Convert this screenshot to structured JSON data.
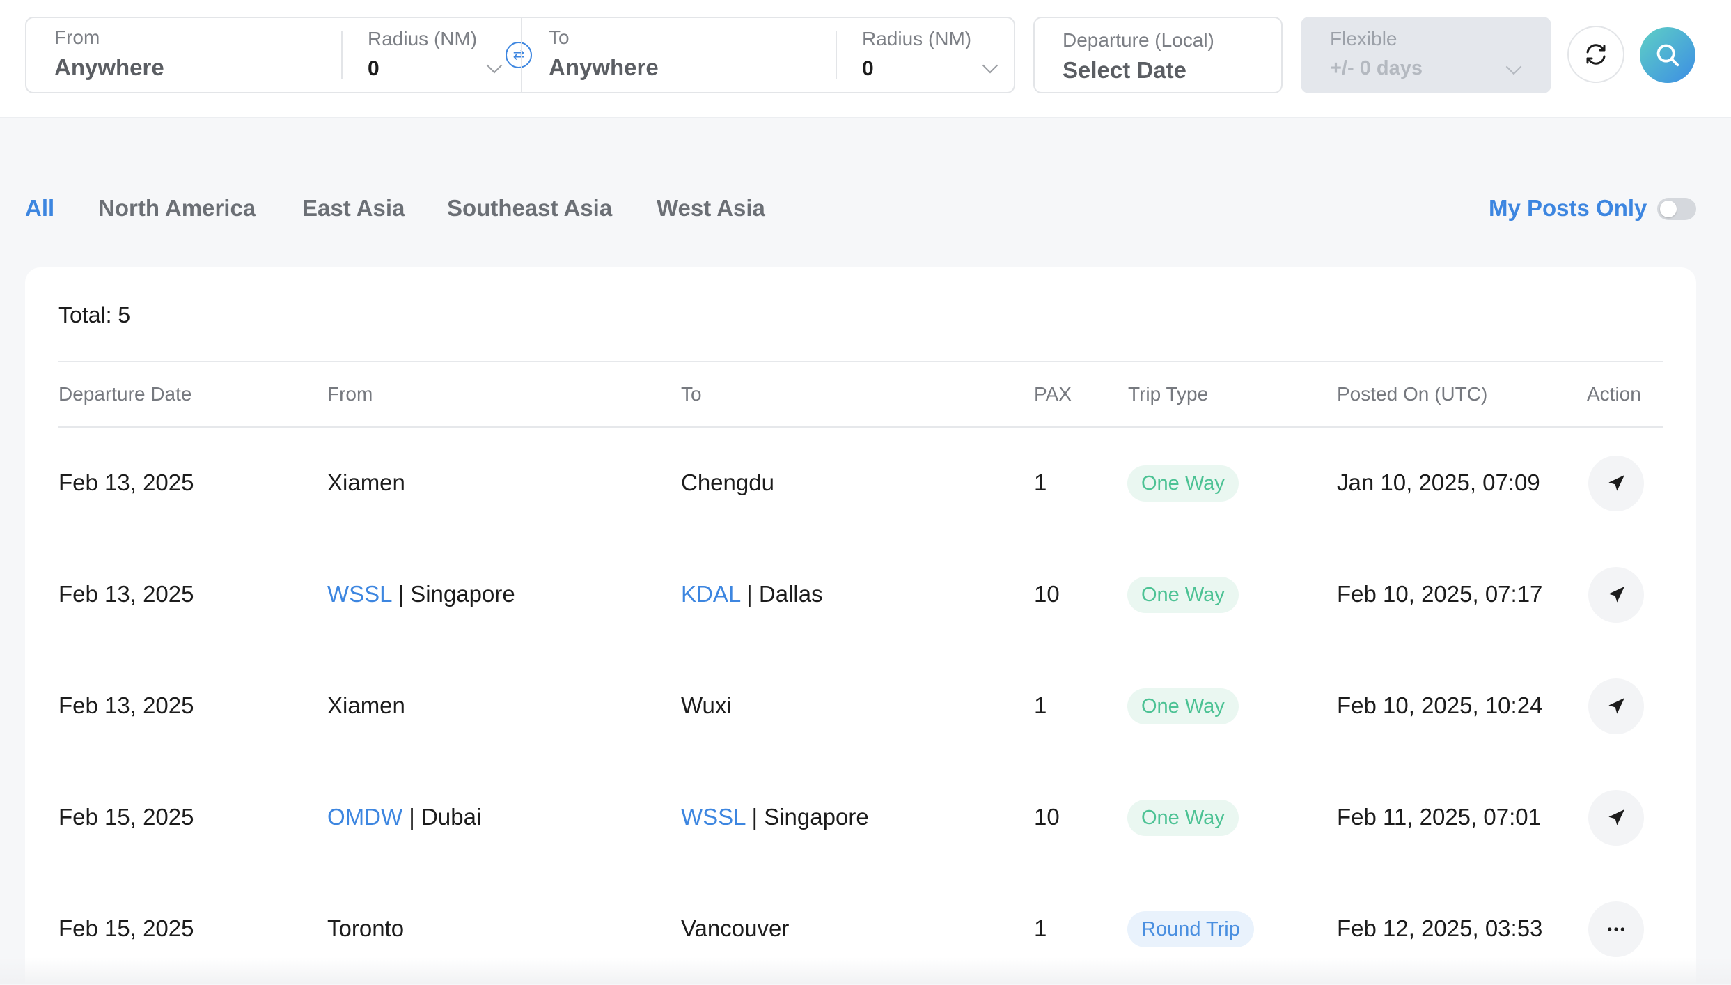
{
  "search": {
    "from": {
      "label": "From",
      "value": "Anywhere"
    },
    "from_radius": {
      "label": "Radius (NM)",
      "value": "0"
    },
    "to": {
      "label": "To",
      "value": "Anywhere"
    },
    "to_radius": {
      "label": "Radius (NM)",
      "value": "0"
    },
    "departure": {
      "label": "Departure (Local)",
      "value": "Select Date"
    },
    "flexible": {
      "label": "Flexible",
      "value": "+/- 0 days"
    }
  },
  "tabs": [
    {
      "label": "All",
      "active": true
    },
    {
      "label": "North America",
      "active": false
    },
    {
      "label": "East Asia",
      "active": false
    },
    {
      "label": "Southeast Asia",
      "active": false
    },
    {
      "label": "West Asia",
      "active": false
    }
  ],
  "my_posts_only": {
    "label": "My Posts Only",
    "on": false
  },
  "table": {
    "total_label": "Total: 5",
    "columns": [
      "Departure Date",
      "From",
      "To",
      "PAX",
      "Trip Type",
      "Posted On (UTC)",
      "Action"
    ],
    "rows": [
      {
        "departure": "Feb 13, 2025",
        "from_code": "",
        "from_city": "Xiamen",
        "to_code": "",
        "to_city": "Chengdu",
        "pax": "1",
        "trip_type": "One Way",
        "posted_on": "Jan 10, 2025, 07:09",
        "action": "send-icon"
      },
      {
        "departure": "Feb 13, 2025",
        "from_code": "WSSL",
        "from_city": "Singapore",
        "to_code": "KDAL",
        "to_city": "Dallas",
        "pax": "10",
        "trip_type": "One Way",
        "posted_on": "Feb 10, 2025, 07:17",
        "action": "send-icon"
      },
      {
        "departure": "Feb 13, 2025",
        "from_code": "",
        "from_city": "Xiamen",
        "to_code": "",
        "to_city": "Wuxi",
        "pax": "1",
        "trip_type": "One Way",
        "posted_on": "Feb 10, 2025, 10:24",
        "action": "send-icon"
      },
      {
        "departure": "Feb 15, 2025",
        "from_code": "OMDW",
        "from_city": "Dubai",
        "to_code": "WSSL",
        "to_city": "Singapore",
        "pax": "10",
        "trip_type": "One Way",
        "posted_on": "Feb 11, 2025, 07:01",
        "action": "send-icon"
      },
      {
        "departure": "Feb 15, 2025",
        "from_code": "",
        "from_city": "Toronto",
        "to_code": "",
        "to_city": "Vancouver",
        "pax": "1",
        "trip_type": "Round Trip",
        "posted_on": "Feb 12, 2025, 03:53",
        "action": "more-icon"
      }
    ]
  },
  "colors": {
    "accent": "#3d86e0",
    "one_way": "#4cc294",
    "round_trip": "#4a8fe0"
  }
}
